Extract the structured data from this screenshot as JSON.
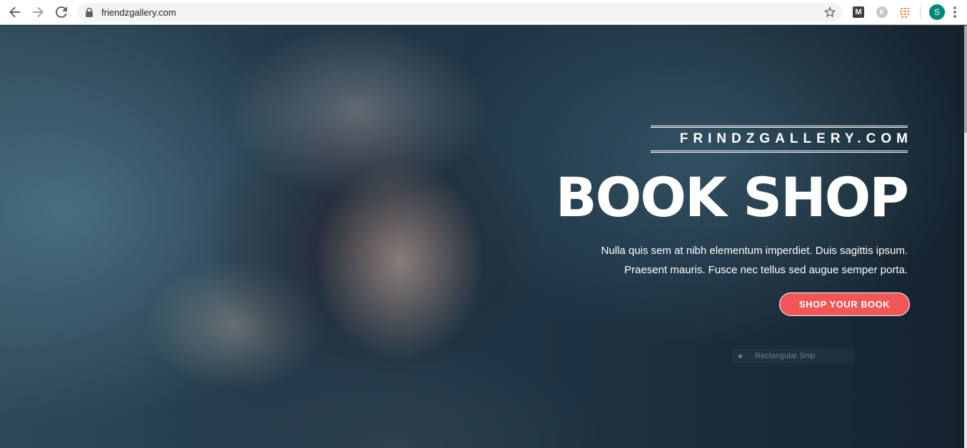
{
  "browser": {
    "url": "friendzgallery.com",
    "profile_initial": "S",
    "extensions": [
      {
        "name": "m-extension-icon",
        "label": "M"
      },
      {
        "name": "k-extension-icon",
        "label": "K"
      },
      {
        "name": "grid-extension-icon",
        "label": ""
      }
    ]
  },
  "hero": {
    "brand": "FRINDZGALLERY.COM",
    "headline": "BOOK SHOP",
    "description": [
      "Nulla quis sem at nibh elementum imperdiet. Duis sagittis ipsum.",
      "Praesent mauris. Fusce nec tellus sed augue semper porta."
    ],
    "cta_label": "SHOP YOUR BOOK",
    "overlay_tooltip": "Rectangular Snip"
  },
  "colors": {
    "accent": "#f25757",
    "text_on_hero": "#ffffff",
    "avatar_bg": "#00897b"
  }
}
